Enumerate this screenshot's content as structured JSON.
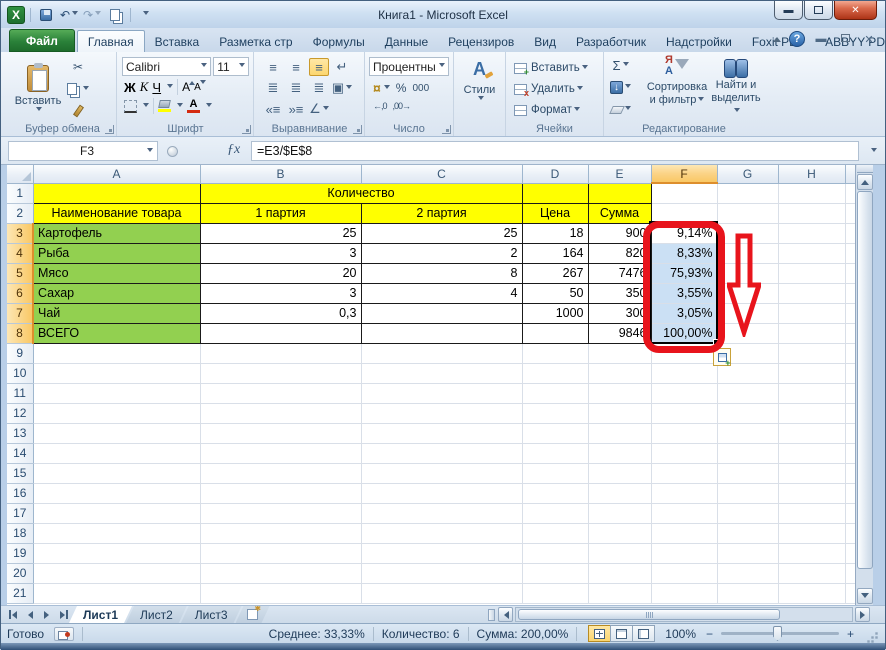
{
  "title_bar": {
    "title": "Книга1  -  Microsoft Excel"
  },
  "ribbon_tabs": [
    {
      "label": "Файл",
      "kind": "file"
    },
    {
      "label": "Главная",
      "kind": "active"
    },
    {
      "label": "Вставка"
    },
    {
      "label": "Разметка стр"
    },
    {
      "label": "Формулы"
    },
    {
      "label": "Данные"
    },
    {
      "label": "Рецензиров"
    },
    {
      "label": "Вид"
    },
    {
      "label": "Разработчик"
    },
    {
      "label": "Надстройки"
    },
    {
      "label": "Foxit PDF"
    },
    {
      "label": "ABBYY PDF Tr"
    }
  ],
  "ribbon": {
    "clipboard": {
      "paste": "Вставить",
      "label": "Буфер обмена"
    },
    "font": {
      "font_name": "Calibri",
      "font_size": "11",
      "bold": "Ж",
      "italic": "К",
      "underline": "Ч",
      "grow": "А",
      "shrink": "А",
      "label": "Шрифт"
    },
    "alignment": {
      "label": "Выравнивание"
    },
    "number": {
      "format": "Процентны",
      "percent": "%",
      "thousands": "000",
      "currency": "¤",
      "inc_decimal": "←,0",
      "dec_decimal": ",00→",
      "label": "Число"
    },
    "styles": {
      "button": "Стили"
    },
    "cells": {
      "insert": "Вставить",
      "delete": "Удалить",
      "format": "Формат",
      "label": "Ячейки"
    },
    "editing": {
      "sum": "Σ",
      "fill": "↓",
      "sort_line1": "Сортировка",
      "sort_line2": "и фильтр",
      "find_line1": "Найти и",
      "find_line2": "выделить",
      "label": "Редактирование"
    }
  },
  "formula_bar": {
    "name_box": "F3",
    "fx": "ƒx",
    "formula": "=E3/$E$8"
  },
  "sheet": {
    "columns": [
      "A",
      "B",
      "C",
      "D",
      "E",
      "F",
      "G",
      "H"
    ],
    "row_count": 21,
    "merged_header": "Количество",
    "header_row": [
      "Наименование товара",
      "1 партия",
      "2 партия",
      "Цена",
      "Сумма"
    ],
    "rows": [
      [
        "Картофель",
        "25",
        "25",
        "18",
        "900",
        "9,14%"
      ],
      [
        "Рыба",
        "3",
        "2",
        "164",
        "820",
        "8,33%"
      ],
      [
        "Мясо",
        "20",
        "8",
        "267",
        "7476",
        "75,93%"
      ],
      [
        "Сахар",
        "3",
        "4",
        "50",
        "350",
        "3,55%"
      ],
      [
        "Чай",
        "0,3",
        "",
        "1000",
        "300",
        "3,05%"
      ],
      [
        "ВСЕГО",
        "",
        "",
        "",
        "9846",
        "100,00%"
      ]
    ],
    "selection": {
      "active_cell": "F3",
      "range": "F3:F8"
    }
  },
  "sheet_tabs": {
    "tabs": [
      "Лист1",
      "Лист2",
      "Лист3"
    ],
    "active": "Лист1"
  },
  "status_bar": {
    "mode": "Готово",
    "average": "Среднее: 33,33%",
    "count": "Количество: 6",
    "sum": "Сумма: 200,00%",
    "zoom": "100%"
  },
  "colors": {
    "cell_yellow": "#FFFF00",
    "cell_green": "#92D050",
    "selection_blue": "#CBE0F4",
    "annotation_red": "#E8141C",
    "header_selected": "#F9C865",
    "file_tab_green": "#2A8139"
  }
}
